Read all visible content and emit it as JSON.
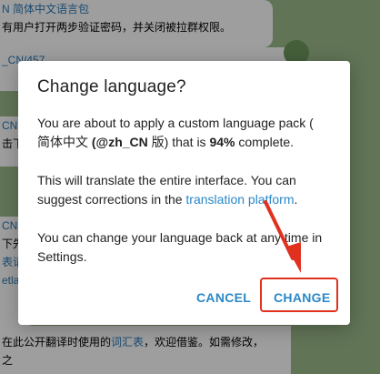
{
  "background": {
    "lines": [
      "N 简体中文语言包",
      "有用户打开两步验证密码，并关闭被拉群权限。",
      "_CN/457",
      "CN",
      "击下",
      "CN",
      "下先",
      "表请",
      "etlan",
      "在此公开翻译时使用的",
      "词汇表",
      "，欢迎借鉴。如需修改，",
      "之"
    ]
  },
  "dialog": {
    "title": "Change language?",
    "para1_a": "You are about to apply a custom language pack (",
    "para1_b": "简体中文",
    "para1_bold1": "(@zh_CN",
    "para1_c": " 版) that is ",
    "para1_bold2": "94%",
    "para1_d": " complete.",
    "para2_a": "This will translate the entire interface. You can suggest corrections in the ",
    "para2_link": "translation platform",
    "para2_b": ".",
    "para3": "You can change your language back at any time in Settings.",
    "cancel_label": "CANCEL",
    "change_label": "CHANGE"
  },
  "colors": {
    "accent": "#2a88c8",
    "highlight": "#e0301e"
  }
}
